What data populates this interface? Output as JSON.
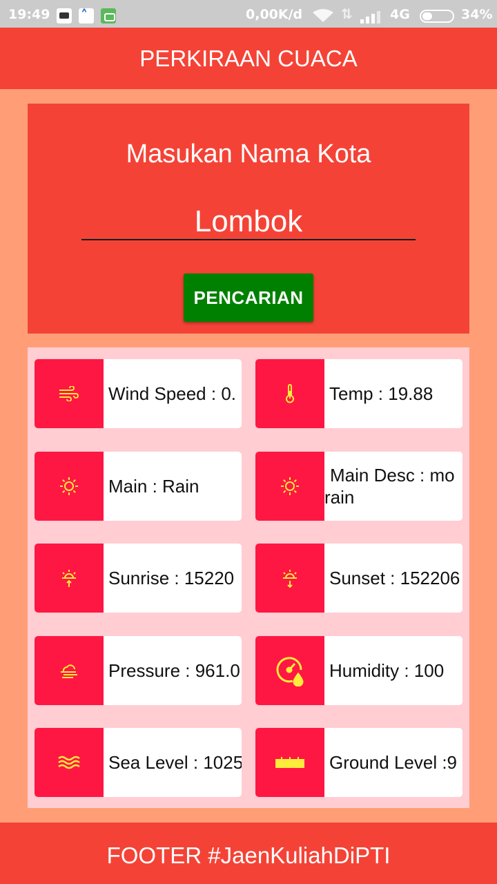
{
  "status_bar": {
    "time": "19:49",
    "network_speed": "0,00K/d",
    "network_type": "4G",
    "battery": "34%"
  },
  "app_bar": {
    "title": "PERKIRAAN CUACA"
  },
  "search": {
    "title": "Masukan Nama Kota",
    "city_value": "Lombok",
    "button_label": "PENCARIAN"
  },
  "weather": {
    "wind_speed": "Wind Speed : 0.",
    "temp": "Temp : 19.88",
    "main": "Main : Rain",
    "main_desc": "Main Desc : mo rain",
    "sunrise": "Sunrise : 15220",
    "sunset": "Sunset : 152206",
    "pressure": "Pressure : 961.0",
    "humidity": "Humidity : 100",
    "sea_level": "Sea Level : 1025",
    "ground_level": "Ground Level :9"
  },
  "footer": {
    "text": "FOOTER #JaenKuliahDiPTI"
  },
  "colors": {
    "primary": "#f44336",
    "background": "#ff9e76",
    "grid_background": "#ffcdd2",
    "icon_tile": "#ff1744",
    "icon": "#ffeb3b",
    "button": "#008000"
  },
  "icons": {
    "wind_speed": "wind-icon",
    "temp": "thermometer-icon",
    "main": "sun-icon",
    "main_desc": "sun-icon",
    "sunrise": "sunrise-icon",
    "sunset": "sunset-icon",
    "pressure": "cloud-wind-icon",
    "humidity": "humidity-gauge-icon",
    "sea_level": "waves-icon",
    "ground_level": "ground-icon"
  }
}
